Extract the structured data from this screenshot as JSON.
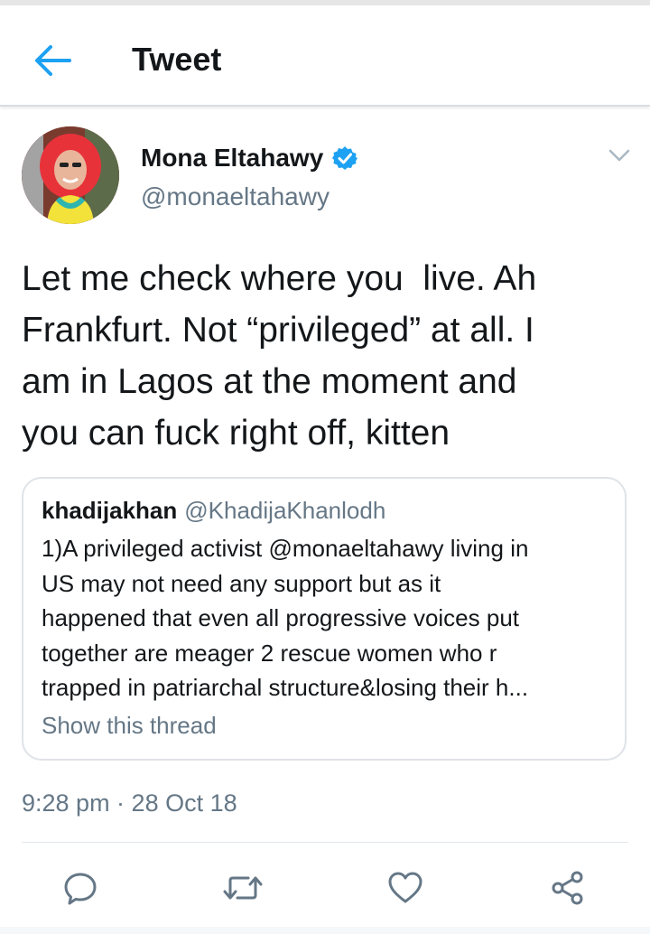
{
  "header": {
    "title": "Tweet",
    "back_icon": "arrow-left-icon",
    "accent": "#1da1f2"
  },
  "tweet": {
    "author_name": "Mona Eltahawy",
    "author_handle": "@monaeltahawy",
    "verified": true,
    "text": "Let me check where you  live. Ah\nFrankfurt. Not “privileged” at all. I\nam in Lagos at the moment and\nyou can fuck right off, kitten",
    "timestamp": "9:28 pm · 28 Oct 18"
  },
  "quoted_tweet": {
    "author_name": "khadijakhan",
    "author_handle": "@KhadijaKhanlodh",
    "text": "1)A privileged activist @monaeltahawy living in\nUS may not need any support but as it\nhappened that even all progressive voices put\ntogether are meager 2 rescue women who r\ntrapped in patriarchal structure&losing their h...",
    "show_thread": "Show this thread"
  },
  "actions": [
    {
      "name": "reply",
      "icon": "reply-icon"
    },
    {
      "name": "retweet",
      "icon": "retweet-icon"
    },
    {
      "name": "like",
      "icon": "heart-icon"
    },
    {
      "name": "share",
      "icon": "share-icon"
    }
  ],
  "colors": {
    "text": "#14171a",
    "secondary": "#657786",
    "border": "#dfe3e8",
    "verified": "#1da1f2"
  }
}
